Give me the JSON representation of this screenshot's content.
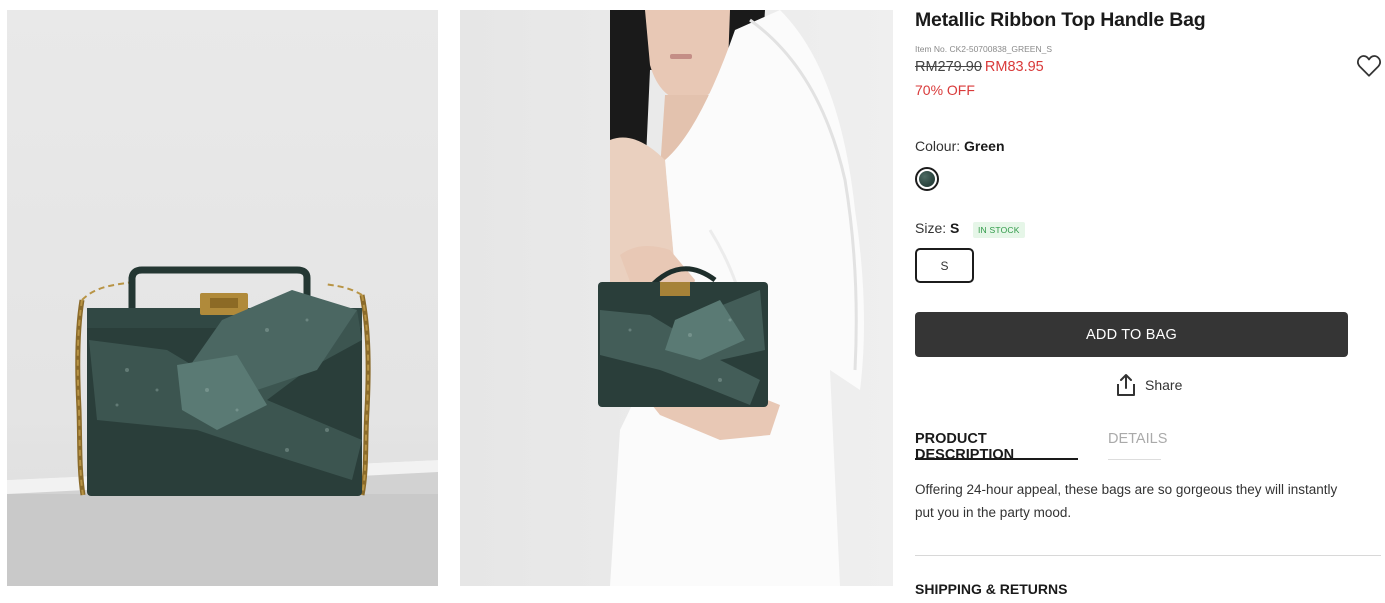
{
  "product": {
    "title": "Metallic Ribbon Top Handle Bag",
    "item_no": "Item No. CK2-50700838_GREEN_S",
    "price_original": "RM279.90",
    "price_sale": "RM83.95",
    "discount": "70% OFF"
  },
  "colour": {
    "label": "Colour:",
    "value": "Green",
    "swatch_color": "#2c4640"
  },
  "size": {
    "label": "Size:",
    "value": "S",
    "stock": "IN STOCK",
    "options": [
      "S"
    ]
  },
  "actions": {
    "add_to_bag": "ADD TO BAG",
    "share": "Share"
  },
  "tabs": {
    "active": "PRODUCT DESCRIPTION",
    "inactive": "DETAILS"
  },
  "description": "Offering 24-hour appeal, these bags are so gorgeous they will instantly put you in the party mood.",
  "shipping": "SHIPPING & RETURNS",
  "icons": {
    "wishlist": "heart-outline-icon",
    "share": "share-upload-icon"
  },
  "colors": {
    "accent_red": "#d93a3a",
    "button_dark": "#353535",
    "stock_green": "#2f9a48"
  }
}
